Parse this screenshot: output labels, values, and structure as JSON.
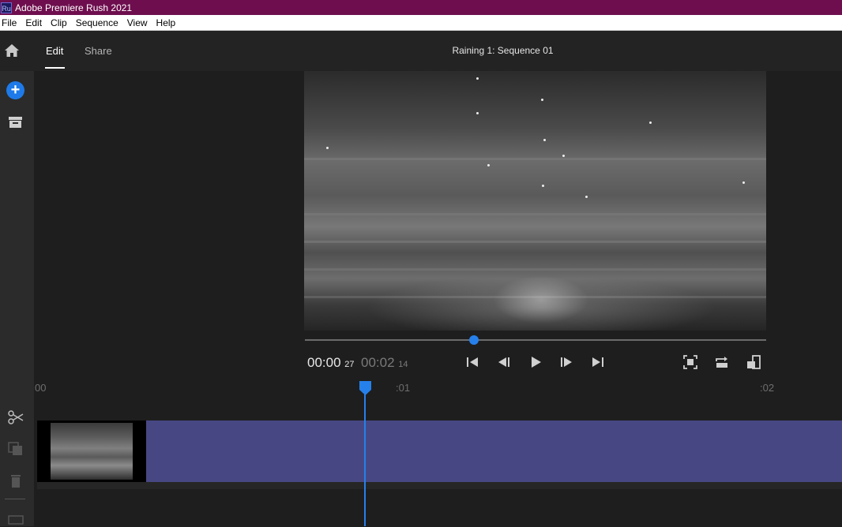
{
  "window": {
    "title": "Adobe Premiere Rush 2021",
    "app_icon_text": "Ru"
  },
  "menu": [
    "File",
    "Edit",
    "Clip",
    "Sequence",
    "View",
    "Help"
  ],
  "tabs": {
    "edit": "Edit",
    "share": "Share"
  },
  "sequence_title": "Raining 1: Sequence 01",
  "timecode": {
    "current_main": "00:00",
    "current_frames": "27",
    "total_main": "00:02",
    "total_frames": "14"
  },
  "ruler": {
    "mark0": "00",
    "mark1": ":01",
    "mark2": ":02"
  },
  "playback": {
    "progress_fraction": 0.37
  },
  "colors": {
    "accent": "#2680eb",
    "titlebar": "#6e0e4e",
    "track": "#474883"
  },
  "icons": [
    "home-icon",
    "add-media-icon",
    "archive-icon",
    "scissors-icon",
    "duplicate-icon",
    "trash-icon",
    "go-to-start-icon",
    "step-back-icon",
    "play-icon",
    "step-forward-icon",
    "go-to-end-icon",
    "fullscreen-icon",
    "loop-icon",
    "aspect-ratio-icon"
  ]
}
